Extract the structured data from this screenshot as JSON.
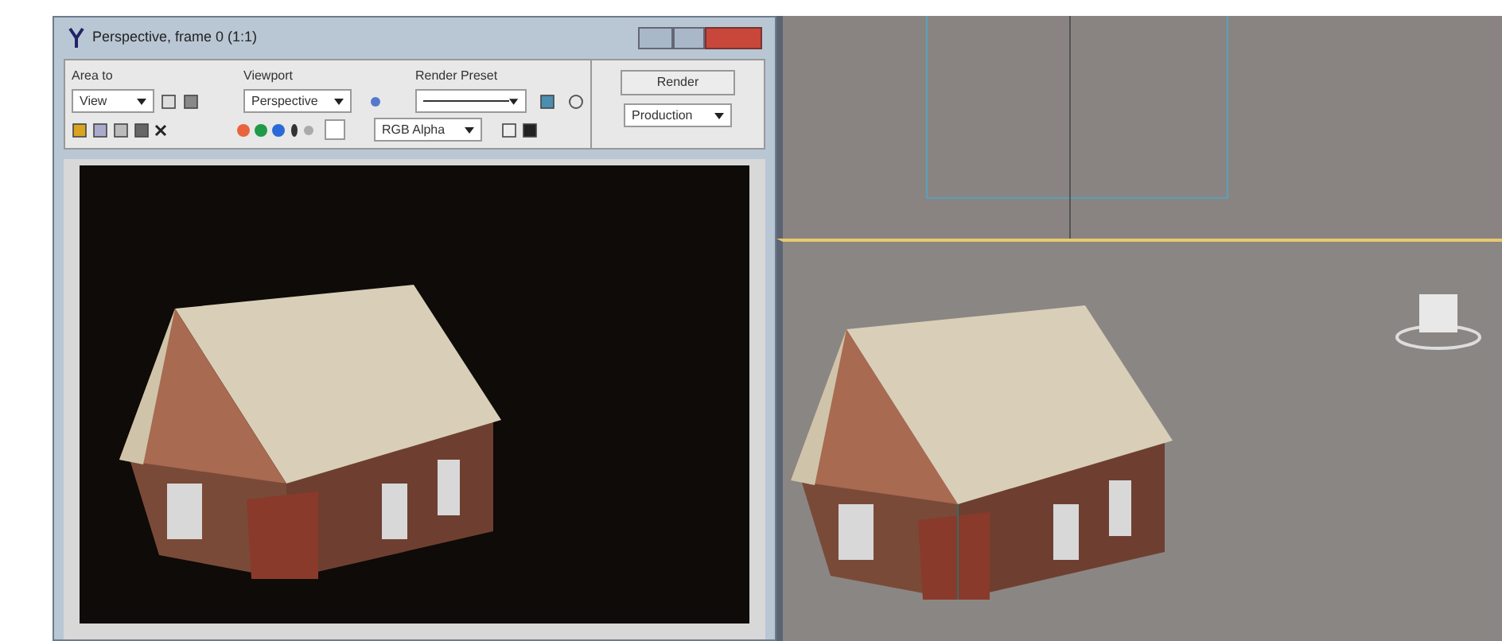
{
  "window": {
    "title": "Perspective, frame 0 (1:1)"
  },
  "toolbar": {
    "area": {
      "label": "Area to",
      "value": "View"
    },
    "viewport": {
      "label": "Viewport",
      "value": "Perspective"
    },
    "preset": {
      "label": "Render Preset"
    },
    "render_button": "Render",
    "mode": "Production",
    "channel_display": "RGB Alpha",
    "channels": [
      {
        "color": "#e8643c"
      },
      {
        "color": "#1f9a48"
      },
      {
        "color": "#2a6ad8"
      }
    ]
  }
}
